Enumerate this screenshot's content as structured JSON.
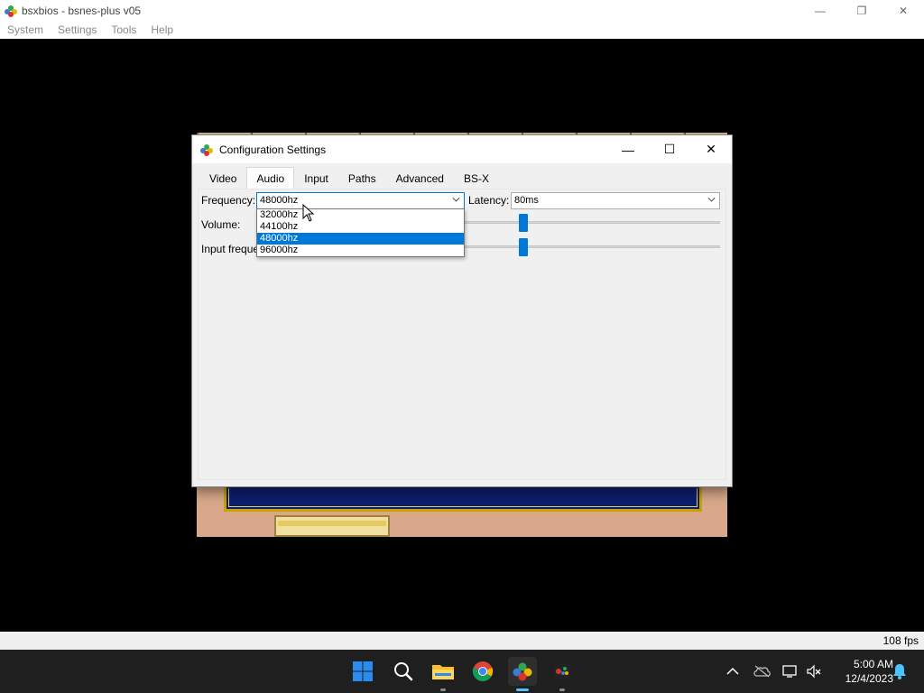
{
  "window": {
    "title": "bsxbios - bsnes-plus v05",
    "controls": {
      "minimize": "—",
      "restore": "❐",
      "close": "✕"
    }
  },
  "menu": {
    "items": [
      {
        "label": "System"
      },
      {
        "label": "Settings"
      },
      {
        "label": "Tools"
      },
      {
        "label": "Help"
      }
    ]
  },
  "status": {
    "fps": "108 fps"
  },
  "dialog": {
    "title": "Configuration Settings",
    "controls": {
      "minimize": "—",
      "maximize": "☐",
      "close": "✕"
    },
    "tabs": [
      {
        "label": "Video"
      },
      {
        "label": "Audio",
        "active": true
      },
      {
        "label": "Input"
      },
      {
        "label": "Paths"
      },
      {
        "label": "Advanced"
      },
      {
        "label": "BS-X"
      }
    ],
    "audio": {
      "frequency_label": "Frequency:",
      "frequency_value": "48000hz",
      "frequency_options": [
        "32000hz",
        "44100hz",
        "48000hz",
        "96000hz"
      ],
      "frequency_selected_index": 2,
      "latency_label": "Latency:",
      "latency_value": "80ms",
      "volume_label": "Volume:",
      "input_frequency_label": "Input freque"
    }
  },
  "taskbar": {
    "icons": [
      "start-icon",
      "search-icon",
      "file-explorer-icon",
      "chrome-icon",
      "bsnes-icon",
      "bsnes-secondary-icon"
    ],
    "tray": {
      "up_arrow": "^"
    },
    "clock": {
      "time": "5:00 AM",
      "date": "12/4/2023"
    }
  },
  "colors": {
    "accent": "#0078d7",
    "taskbar_bg": "#1f1f1f",
    "dialog_bg": "#f0f0f0"
  }
}
